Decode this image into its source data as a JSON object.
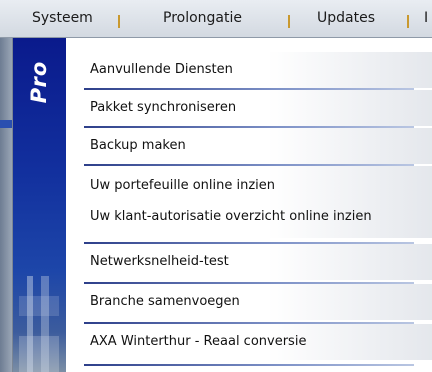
{
  "menubar": {
    "items": [
      "Systeem",
      "Prolongatie",
      "Updates",
      "I"
    ]
  },
  "brand": {
    "logo_text": "Pro"
  },
  "menu": {
    "items": [
      "Aanvullende Diensten",
      "Pakket synchroniseren",
      "Backup maken",
      "Uw portefeuille online inzien",
      "Uw klant-autorisatie overzicht online inzien",
      "Netwerksnelheid-test",
      "Branche samenvoegen",
      "AXA Winterthur - Reaal conversie"
    ]
  },
  "colors": {
    "brand_panel": "#12309e",
    "divider": "#2d3f8a",
    "menubar_separator": "#c9992f"
  }
}
